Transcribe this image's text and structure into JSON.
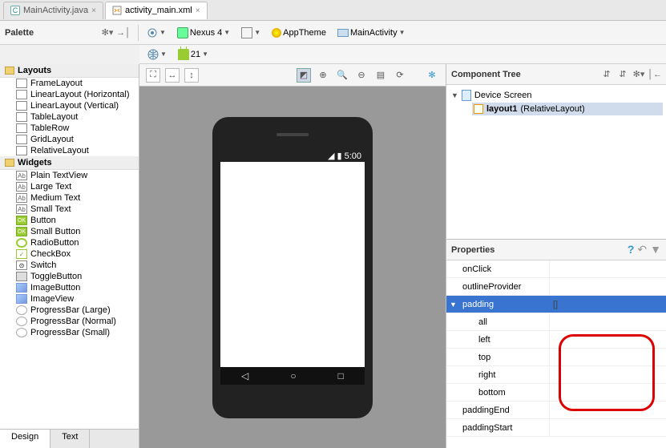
{
  "tabs": {
    "file1": "MainActivity.java",
    "file2": "activity_main.xml"
  },
  "toolbar": {
    "palette_label": "Palette",
    "device": "Nexus 4",
    "theme": "AppTheme",
    "activity": "MainActivity",
    "api": "21"
  },
  "palette": {
    "layouts_header": "Layouts",
    "widgets_header": "Widgets",
    "layouts": {
      "frame": "FrameLayout",
      "linh": "LinearLayout (Horizontal)",
      "linv": "LinearLayout (Vertical)",
      "table": "TableLayout",
      "row": "TableRow",
      "grid": "GridLayout",
      "rel": "RelativeLayout"
    },
    "widgets": {
      "ptv": "Plain TextView",
      "lgt": "Large Text",
      "mdt": "Medium Text",
      "smt": "Small Text",
      "btn": "Button",
      "sbtn": "Small Button",
      "radio": "RadioButton",
      "check": "CheckBox",
      "sw": "Switch",
      "tog": "ToggleButton",
      "imgb": "ImageButton",
      "imgv": "ImageView",
      "pbl": "ProgressBar (Large)",
      "pbn": "ProgressBar (Normal)",
      "pbs": "ProgressBar (Small)"
    }
  },
  "bottom_tabs": {
    "design": "Design",
    "text": "Text"
  },
  "phone": {
    "time": "5:00"
  },
  "component_tree": {
    "title": "Component Tree",
    "device": "Device Screen",
    "layout_name": "layout1",
    "layout_type": " (RelativeLayout)"
  },
  "properties": {
    "title": "Properties",
    "onClick": "onClick",
    "outlineProvider": "outlineProvider",
    "padding": "padding",
    "padding_val": "[]",
    "all": "all",
    "left": "left",
    "top": "top",
    "right": "right",
    "bottom": "bottom",
    "paddingEnd": "paddingEnd",
    "paddingStart": "paddingStart"
  }
}
